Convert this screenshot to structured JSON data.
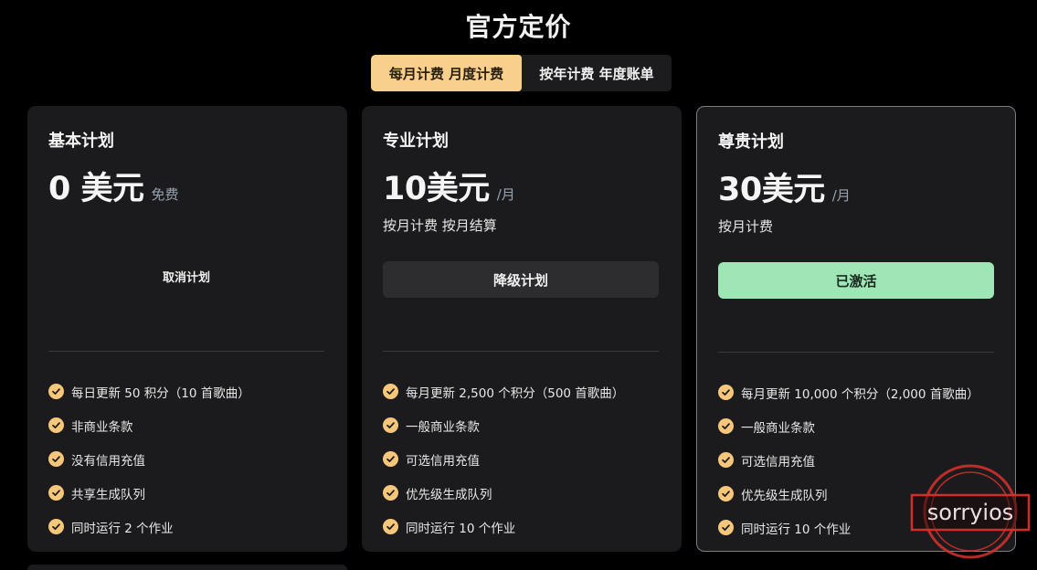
{
  "header": {
    "title": "官方定价"
  },
  "billing_toggle": {
    "monthly": "每月计费 月度计费",
    "yearly": "按年计费 年度账单",
    "selected": "monthly"
  },
  "plans": [
    {
      "name": "基本计划",
      "price": "0 美元",
      "unit": "免费",
      "billing": "",
      "action": "取消计划",
      "features": [
        "每日更新 50 积分（10 首歌曲）",
        "非商业条款",
        "没有信用充值",
        "共享生成队列",
        "同时运行 2 个作业"
      ]
    },
    {
      "name": "专业计划",
      "price": "10美元",
      "unit": "/月",
      "billing": "按月计费 按月结算",
      "action": "降级计划",
      "features": [
        "每月更新 2,500 个积分（500 首歌曲）",
        "一般商业条款",
        "可选信用充值",
        "优先级生成队列",
        "同时运行 10 个作业"
      ]
    },
    {
      "name": "尊贵计划",
      "price": "30美元",
      "unit": "/月",
      "billing": "按月计费",
      "action": "已激活",
      "features": [
        "每月更新 10,000 个积分（2,000 首歌曲）",
        "一般商业条款",
        "可选信用充值",
        "优先级生成队列",
        "同时运行 10 个作业"
      ]
    }
  ],
  "watermark": {
    "text": "sorryios"
  },
  "colors": {
    "background": "#000000",
    "card": "#1b1b1d",
    "accent_gold": "#f9cf8c",
    "active_green": "#9ee6b5",
    "stamp_red": "#d9302b"
  },
  "icons": {
    "feature_check": "check-circle-icon"
  }
}
